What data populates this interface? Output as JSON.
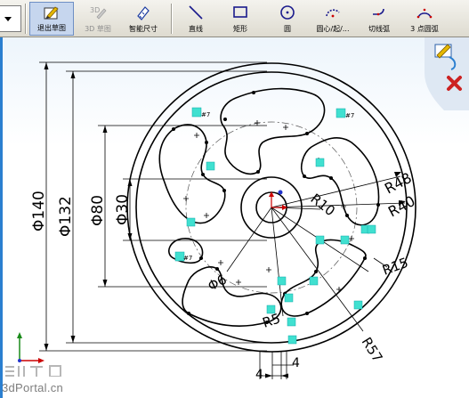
{
  "toolbar": {
    "exit_sketch": "退出草图",
    "sketch_3d": "3D 草图",
    "smart_dimension": "智能尺寸",
    "line": "直线",
    "rectangle": "矩形",
    "circle": "圆",
    "centerpoint_arc": "圆心/起/...",
    "tangent_arc": "切线弧",
    "three_point_arc": "3 点圆弧"
  },
  "dimensions": {
    "d140": "Φ140",
    "d132": "Φ132",
    "d80": "Φ80",
    "d30": "Φ30",
    "d6": "Φ6",
    "r10": "R10",
    "r40": "R40",
    "r48": "R48",
    "r15": "R15",
    "r5": "R5",
    "r57": "R57",
    "w4a": "4",
    "w4b": "4"
  },
  "watermark": {
    "site": "3dPortal.cn"
  },
  "colors": {
    "exit_icon": "#e6b800",
    "relation_badge": "#40e0d0",
    "confirm_red": "#cc2222",
    "origin_red": "#cc0000"
  }
}
